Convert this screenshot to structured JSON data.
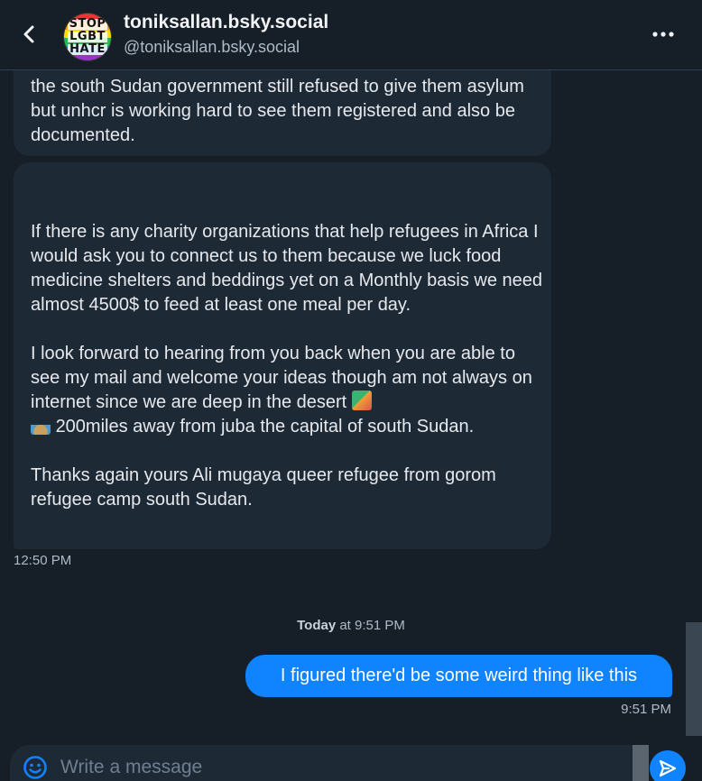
{
  "header": {
    "display_name": "toniksallan.bsky.social",
    "handle": "@toniksallan.bsky.social",
    "avatar_text": [
      "STOP",
      "LGBT",
      "HATE"
    ]
  },
  "messages": {
    "incoming_1": {
      "text": "the south Sudan government still refused to give them asylum but unhcr is working hard to see them registered and also be documented."
    },
    "incoming_2": {
      "paragraphs": [
        "If there is any charity organizations that help refugees in Africa I would ask you to connect us to them because we luck food medicine shelters and beddings yet on a Monthly basis we need almost 4500$ to feed at least one meal per day.",
        "I look forward to hearing from you back when you are able to see my mail and welcome your ideas though am not always on internet since we are deep in the desert",
        "200miles away from juba the capital of south Sudan.",
        "Thanks again yours Ali mugaya queer refugee from gorom refugee camp south Sudan."
      ],
      "emojis": [
        "map-emoji",
        "desert-island-emoji"
      ],
      "time": "12:50 PM"
    },
    "date_separator": {
      "day": "Today",
      "time": "at 9:51 PM"
    },
    "outgoing_1": {
      "text": "I figured there'd be some weird thing like this",
      "time": "9:51 PM"
    }
  },
  "composer": {
    "placeholder": "Write a message",
    "value": ""
  },
  "colors": {
    "background": "#161e27",
    "incoming_bubble": "#1e2936",
    "outgoing_bubble": "#1083fe",
    "accent": "#1083fe",
    "muted_text": "#aebbc9"
  }
}
